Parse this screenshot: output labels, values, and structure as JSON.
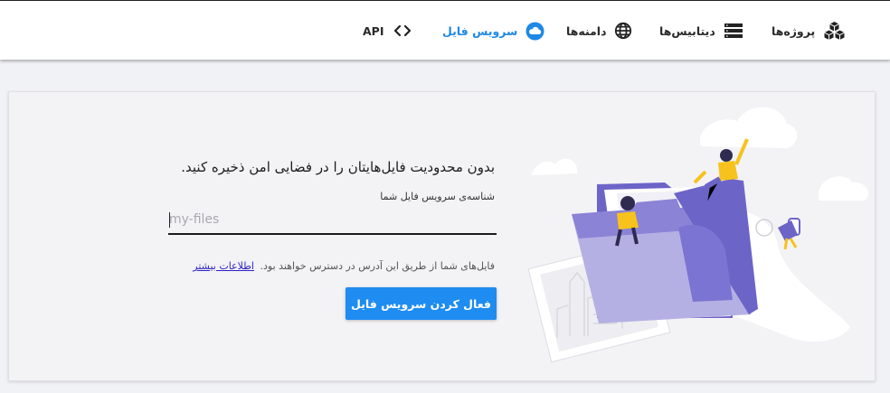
{
  "nav": {
    "items": [
      {
        "label": "پروژه‌ها",
        "icon": "cubes-icon"
      },
      {
        "label": "دیتابیس‌ها",
        "icon": "database-icon"
      },
      {
        "label": "دامنه‌ها",
        "icon": "globe-icon"
      },
      {
        "label": "سرویس فایل",
        "icon": "cloud-icon",
        "active": true
      },
      {
        "label": "API",
        "icon": "code-icon"
      }
    ]
  },
  "main": {
    "heading": "بدون محدودیت فایل‌هایتان را در فضایی امن ذخیره کنید.",
    "field_label": "شناسه‌ی سرویس فایل شما",
    "field_placeholder": "my-files",
    "field_value": "",
    "hint_text": "فایل‌های شما از طریق این آدرس در دسترس خواهند بود.",
    "hint_link": "اطلاعات بیشتر",
    "activate_button": "فعال کردن سرویس فایل"
  },
  "colors": {
    "accent": "#1e88e5",
    "button": "#1e8cf0",
    "illustration_purple": "#6c63c7",
    "illustration_yellow": "#f7c21c"
  }
}
